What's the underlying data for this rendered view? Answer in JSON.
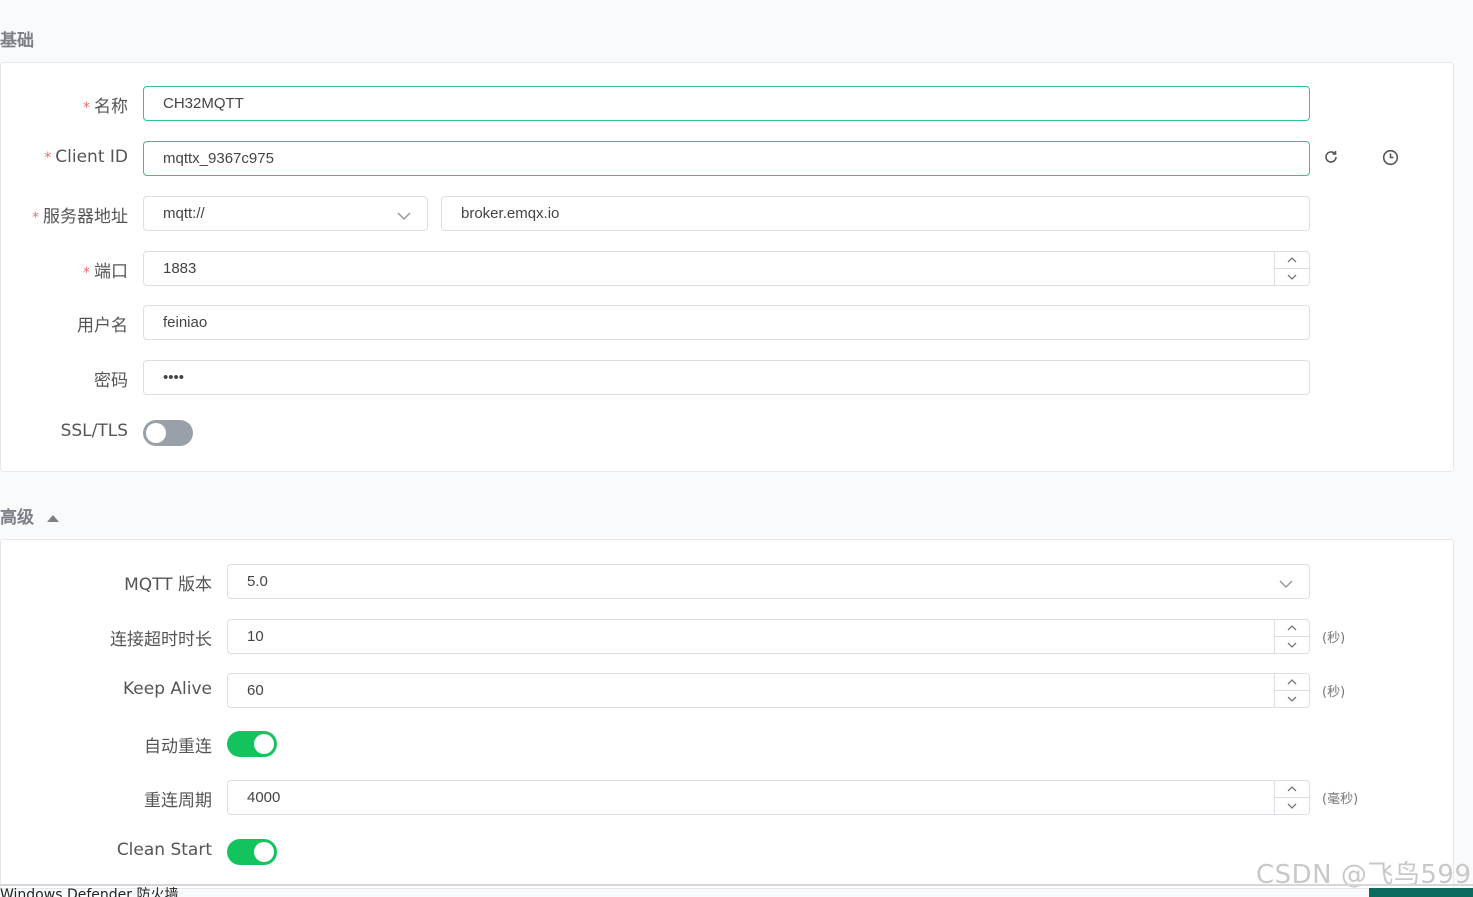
{
  "basic": {
    "title": "基础",
    "name": {
      "label": "名称",
      "value": "CH32MQTT",
      "required": "*"
    },
    "client_id": {
      "label": "Client ID",
      "value": "mqttx_9367c975",
      "required": "*"
    },
    "host": {
      "label": "服务器地址",
      "protocol": "mqtt://",
      "value": "broker.emqx.io",
      "required": "*"
    },
    "port": {
      "label": "端口",
      "value": "1883",
      "required": "*"
    },
    "username": {
      "label": "用户名",
      "value": "feiniao"
    },
    "password": {
      "label": "密码",
      "value": "••••"
    },
    "ssl": {
      "label": "SSL/TLS",
      "enabled": false
    }
  },
  "advanced": {
    "title": "高级",
    "mqtt_version": {
      "label": "MQTT 版本",
      "value": "5.0"
    },
    "connect_timeout": {
      "label": "连接超时时长",
      "value": "10",
      "unit": "(秒)"
    },
    "keep_alive": {
      "label": "Keep Alive",
      "value": "60",
      "unit": "(秒)"
    },
    "auto_reconnect": {
      "label": "自动重连",
      "enabled": true
    },
    "reconnect_period": {
      "label": "重连周期",
      "value": "4000",
      "unit": "(毫秒)"
    },
    "clean_start": {
      "label": "Clean Start",
      "enabled": true
    }
  },
  "overlay": {
    "watermark": "CSDN @飞鸟599",
    "taskbar_text": "Windows Defender 防火墙"
  },
  "colors": {
    "accent": "#13c45e",
    "focus_border": "#34c388",
    "required": "#f56c6c"
  }
}
